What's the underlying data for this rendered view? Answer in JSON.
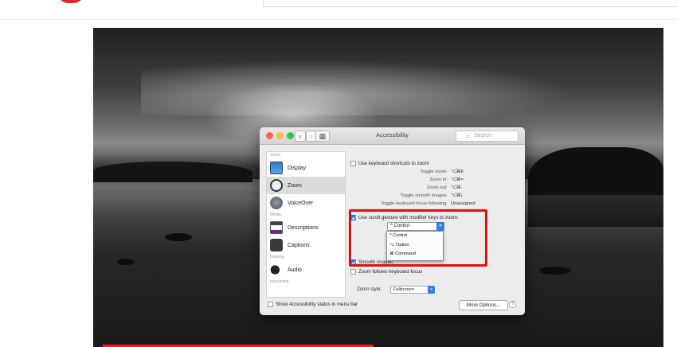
{
  "colors": {
    "accent": "#2f7ef0",
    "highlight": "#e01010",
    "brand": "#d8262a"
  },
  "window": {
    "title": "Accessibility",
    "search_placeholder": "Search",
    "nav": {
      "back_icon": "‹",
      "forward_icon": "›",
      "grid_icon": "▦"
    }
  },
  "sidebar": {
    "sections": {
      "vision": "Vision",
      "media": "Media",
      "hearing": "Hearing",
      "interacting": "Interacting"
    },
    "items": [
      {
        "label": "Display",
        "icon": "display-icon"
      },
      {
        "label": "Zoom",
        "icon": "zoom-icon",
        "selected": true
      },
      {
        "label": "VoiceOver",
        "icon": "voiceover-icon"
      },
      {
        "label": "Descriptions",
        "icon": "descriptions-icon"
      },
      {
        "label": "Captions",
        "icon": "captions-icon"
      },
      {
        "label": "Audio",
        "icon": "audio-icon"
      }
    ]
  },
  "zoom": {
    "keyboard_shortcuts_label": "Use keyboard shortcuts to zoom",
    "keyboard_shortcuts_checked": false,
    "shortcuts": [
      {
        "name": "Toggle zoom:",
        "keys": "⌥⌘8"
      },
      {
        "name": "Zoom in:",
        "keys": "⌥⌘="
      },
      {
        "name": "Zoom out:",
        "keys": "⌥⌘-"
      },
      {
        "name": "Toggle smooth images:",
        "keys": "⌥⌘\\"
      },
      {
        "name": "Toggle keyboard focus following:",
        "keys": "Unassigned"
      }
    ],
    "scroll_gesture_label": "Use scroll gesture with modifier keys to zoom:",
    "scroll_gesture_checked": true,
    "modifier_selected": "^ Control",
    "modifier_options": [
      "^ Control",
      "⌥ Option",
      "⌘ Command"
    ],
    "smooth_label": "Smooth images",
    "smooth_checked": true,
    "zoom_follows_label": "Zoom follows keyboard focus",
    "zoom_follows_checked": false,
    "zoom_style_label": "Zoom style:",
    "zoom_style_value": "Fullscreen",
    "more_options_label": "More Options..."
  },
  "bottom": {
    "show_status_label": "Show Accessibility status in menu bar",
    "show_status_checked": false,
    "help_label": "?"
  }
}
